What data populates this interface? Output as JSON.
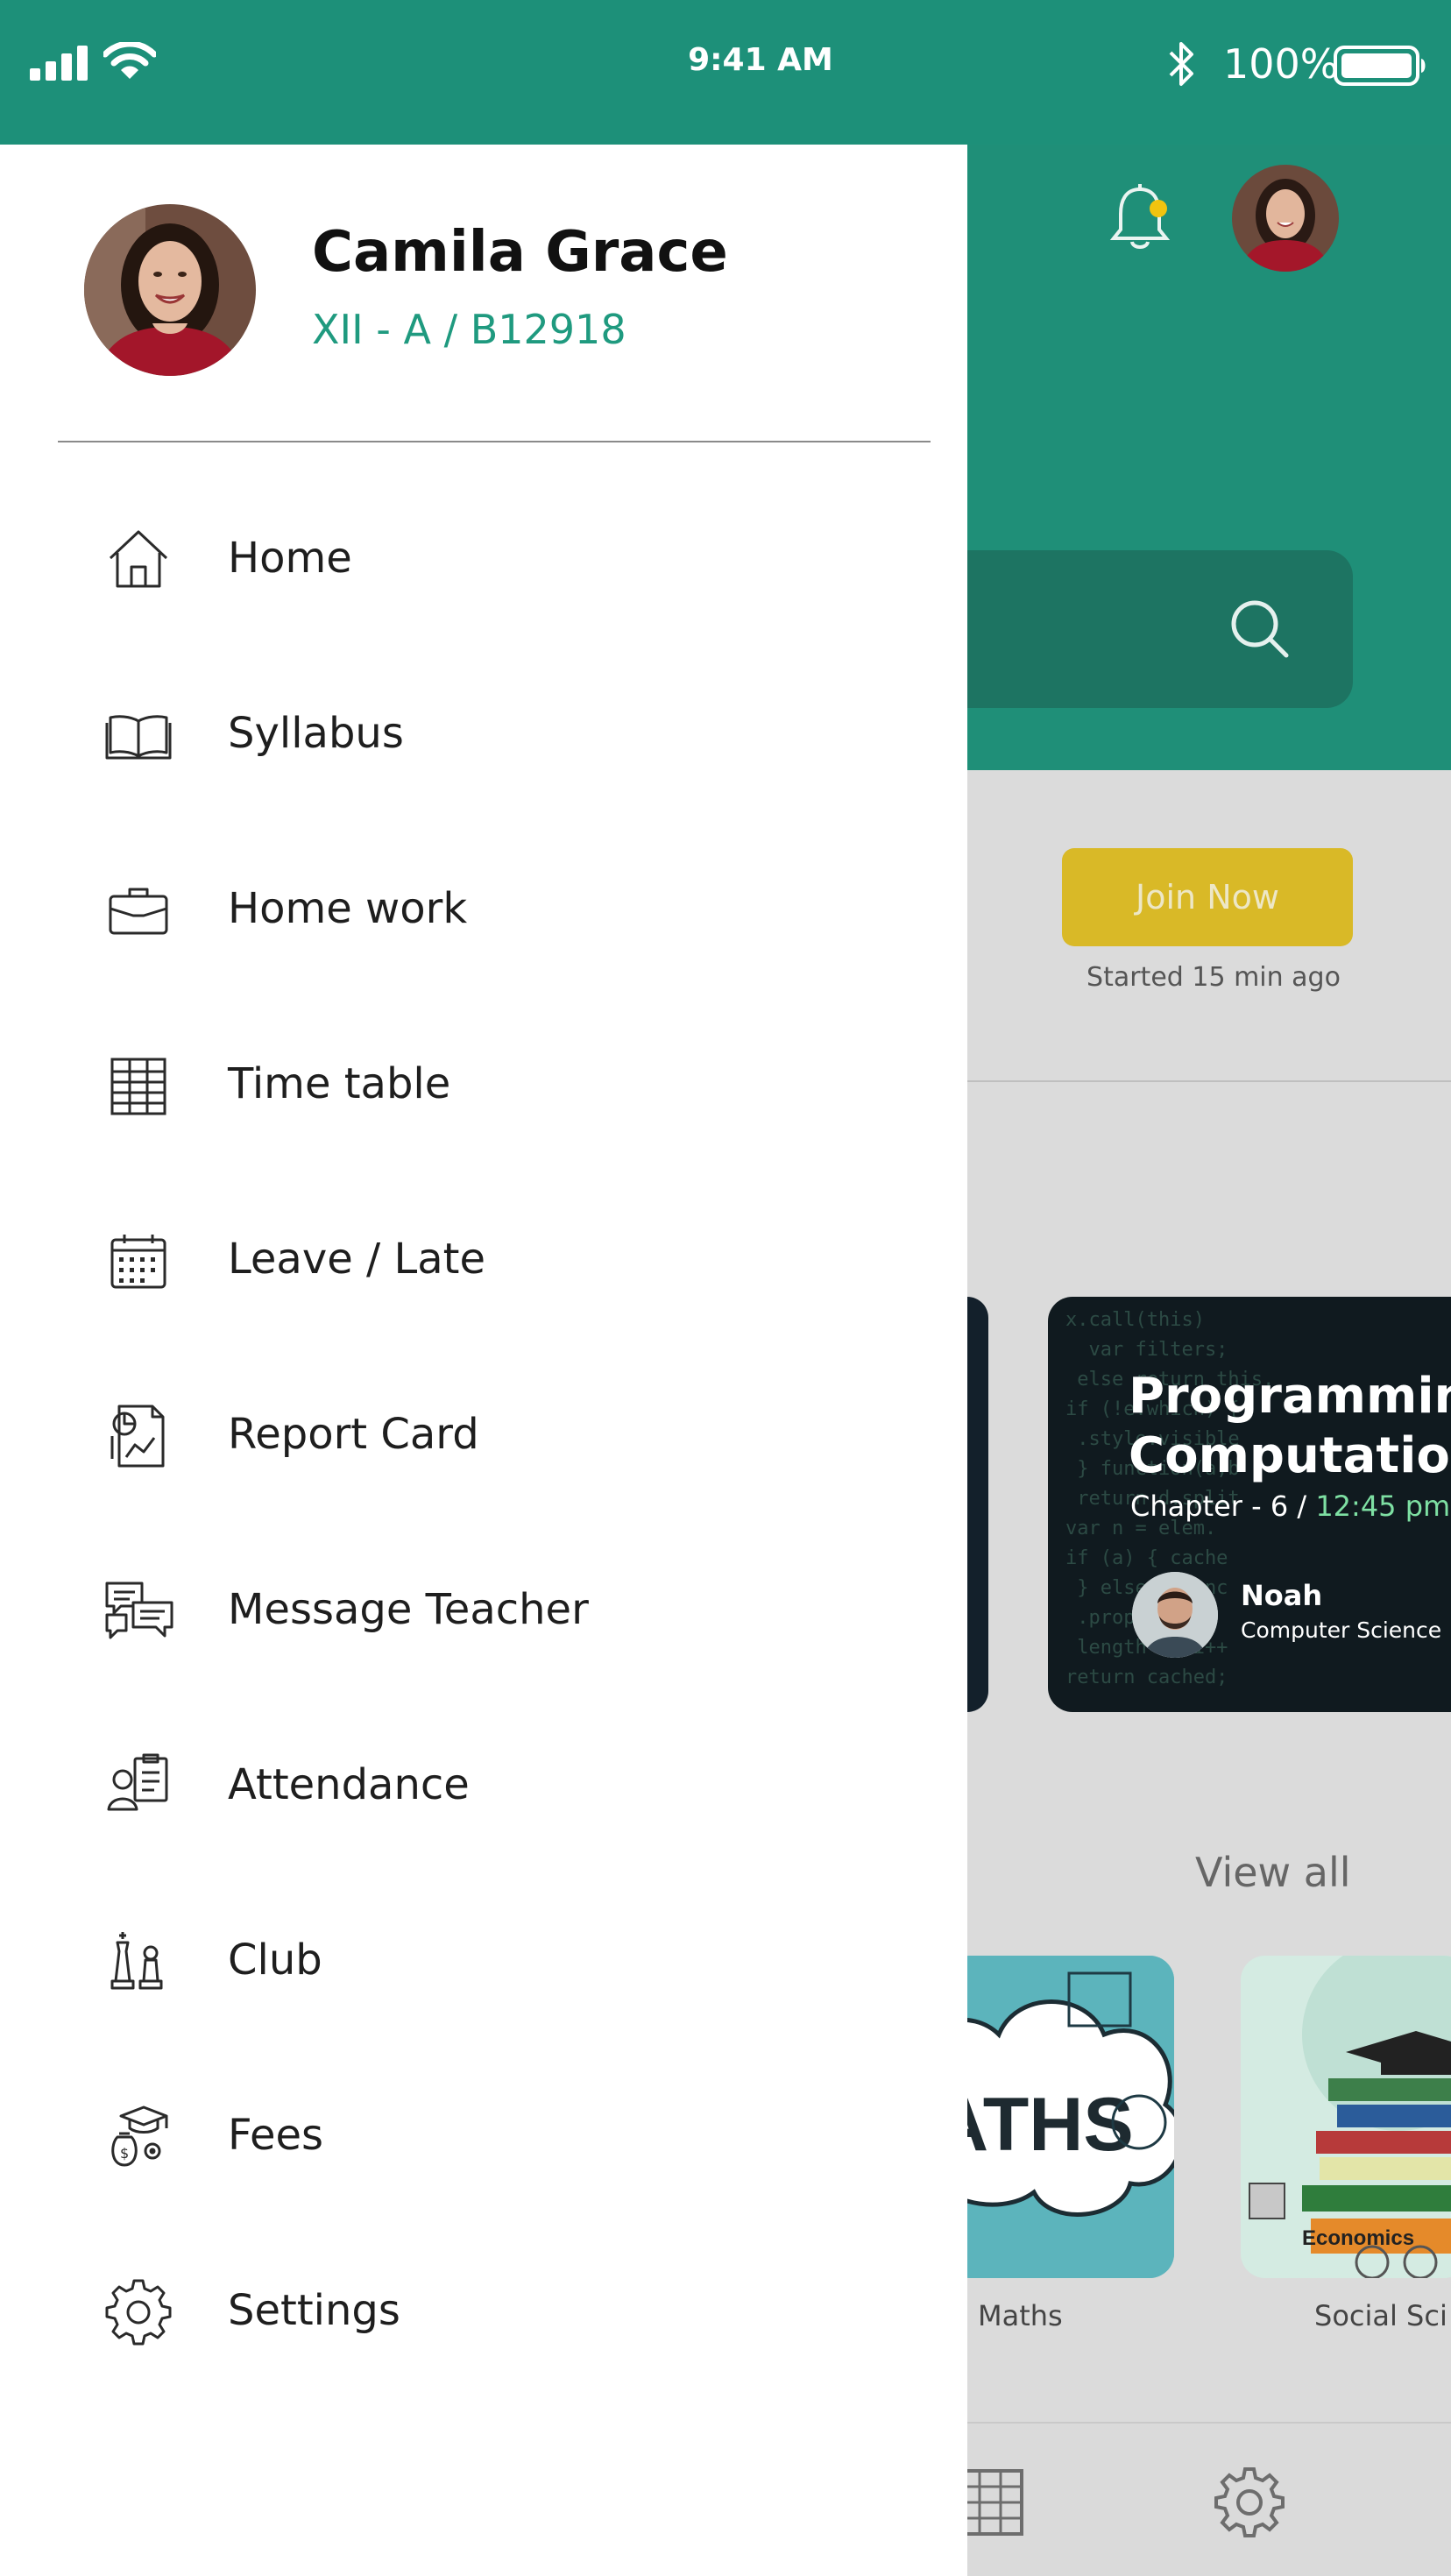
{
  "status_bar": {
    "time": "9:41 AM",
    "battery": "100%"
  },
  "drawer": {
    "profile": {
      "name": "Camila Grace",
      "class_id": "XII - A / B12918"
    },
    "menu": [
      {
        "label": "Home",
        "icon": "home-icon"
      },
      {
        "label": "Syllabus",
        "icon": "book-icon"
      },
      {
        "label": "Home work",
        "icon": "briefcase-icon"
      },
      {
        "label": "Time table",
        "icon": "table-grid-icon"
      },
      {
        "label": "Leave / Late",
        "icon": "calendar-icon"
      },
      {
        "label": "Report Card",
        "icon": "report-card-icon"
      },
      {
        "label": "Message Teacher",
        "icon": "chat-bubbles-icon"
      },
      {
        "label": "Attendance",
        "icon": "attendance-icon"
      },
      {
        "label": "Club",
        "icon": "chess-icon"
      },
      {
        "label": "Fees",
        "icon": "fees-icon"
      },
      {
        "label": "Settings",
        "icon": "gear-icon"
      }
    ]
  },
  "background": {
    "live_class": {
      "join_label": "Join Now",
      "started": "Started 15 min ago"
    },
    "class_card": {
      "title": "Programmin\nComputation",
      "chapter": "Chapter - 6",
      "separator": "/",
      "time": "12:45 pm",
      "teacher_name": "Noah",
      "teacher_subject": "Computer Science"
    },
    "subjects": {
      "view_all": "View all",
      "items": [
        "Maths",
        "Social Sci"
      ],
      "maths_art": "ATHS"
    }
  },
  "colors": {
    "primary": "#1d9079",
    "accent_yellow": "#d9b927",
    "drawer_bg": "#ffffff",
    "class_text": "#1f9a7f"
  }
}
